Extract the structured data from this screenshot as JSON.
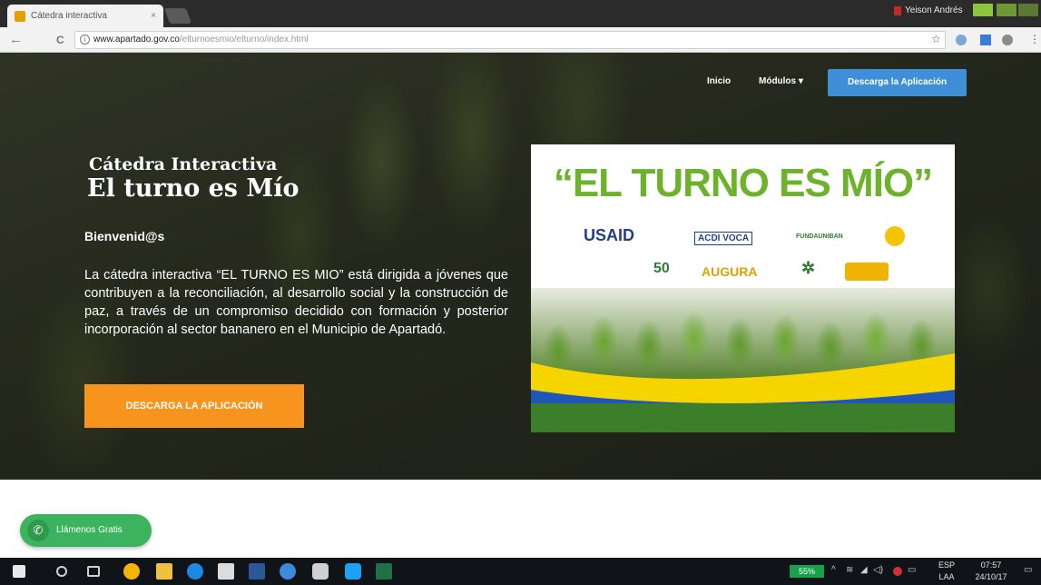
{
  "browser": {
    "tab_title": "Cátedra interactiva",
    "tab_close": "×",
    "profile_name": "Yeison Andrés",
    "url_host": "www.apartado.gov.co",
    "url_path": "/elturnoesmio/elturno/index.html",
    "back_glyph": "←",
    "reload_glyph": "C",
    "star_glyph": "☆",
    "more_glyph": "⋮"
  },
  "nav": {
    "inicio": "Inicio",
    "modulos": "Módulos ▾",
    "download_cta": "Descarga la Aplicación"
  },
  "hero": {
    "subtitle": "Cátedra Interactiva",
    "title": "El turno es Mío",
    "welcome": "Bienvenid@s",
    "description": "La cátedra interactiva “EL TURNO ES MIO” está dirigida a jóvenes que contribuyen a la reconciliación, al desarrollo social y la construcción de paz, a través de un compromiso decidido con formación y posterior incorporación al sector bananero en el Municipio de Apartadó.",
    "cta_label": "DESCARGA LA APLICACIÓN"
  },
  "promo": {
    "title": "“EL TURNO  ES MÍO”",
    "logos": [
      "USAID",
      "ACDI VOCA",
      "FUNDAUNIBAN",
      "50",
      "AUGURA"
    ]
  },
  "call_widget": {
    "label": "Llámenos Gratis",
    "icon": "phone-icon"
  },
  "taskbar": {
    "battery": "55%",
    "lang": "ESP",
    "lang2": "LAA",
    "time": "07:57",
    "date": "24/10/17"
  },
  "colors": {
    "accent_orange": "#f7941d",
    "accent_blue": "#3f8fd8",
    "promo_green": "#6cb32b",
    "call_green": "#3cb35e"
  }
}
